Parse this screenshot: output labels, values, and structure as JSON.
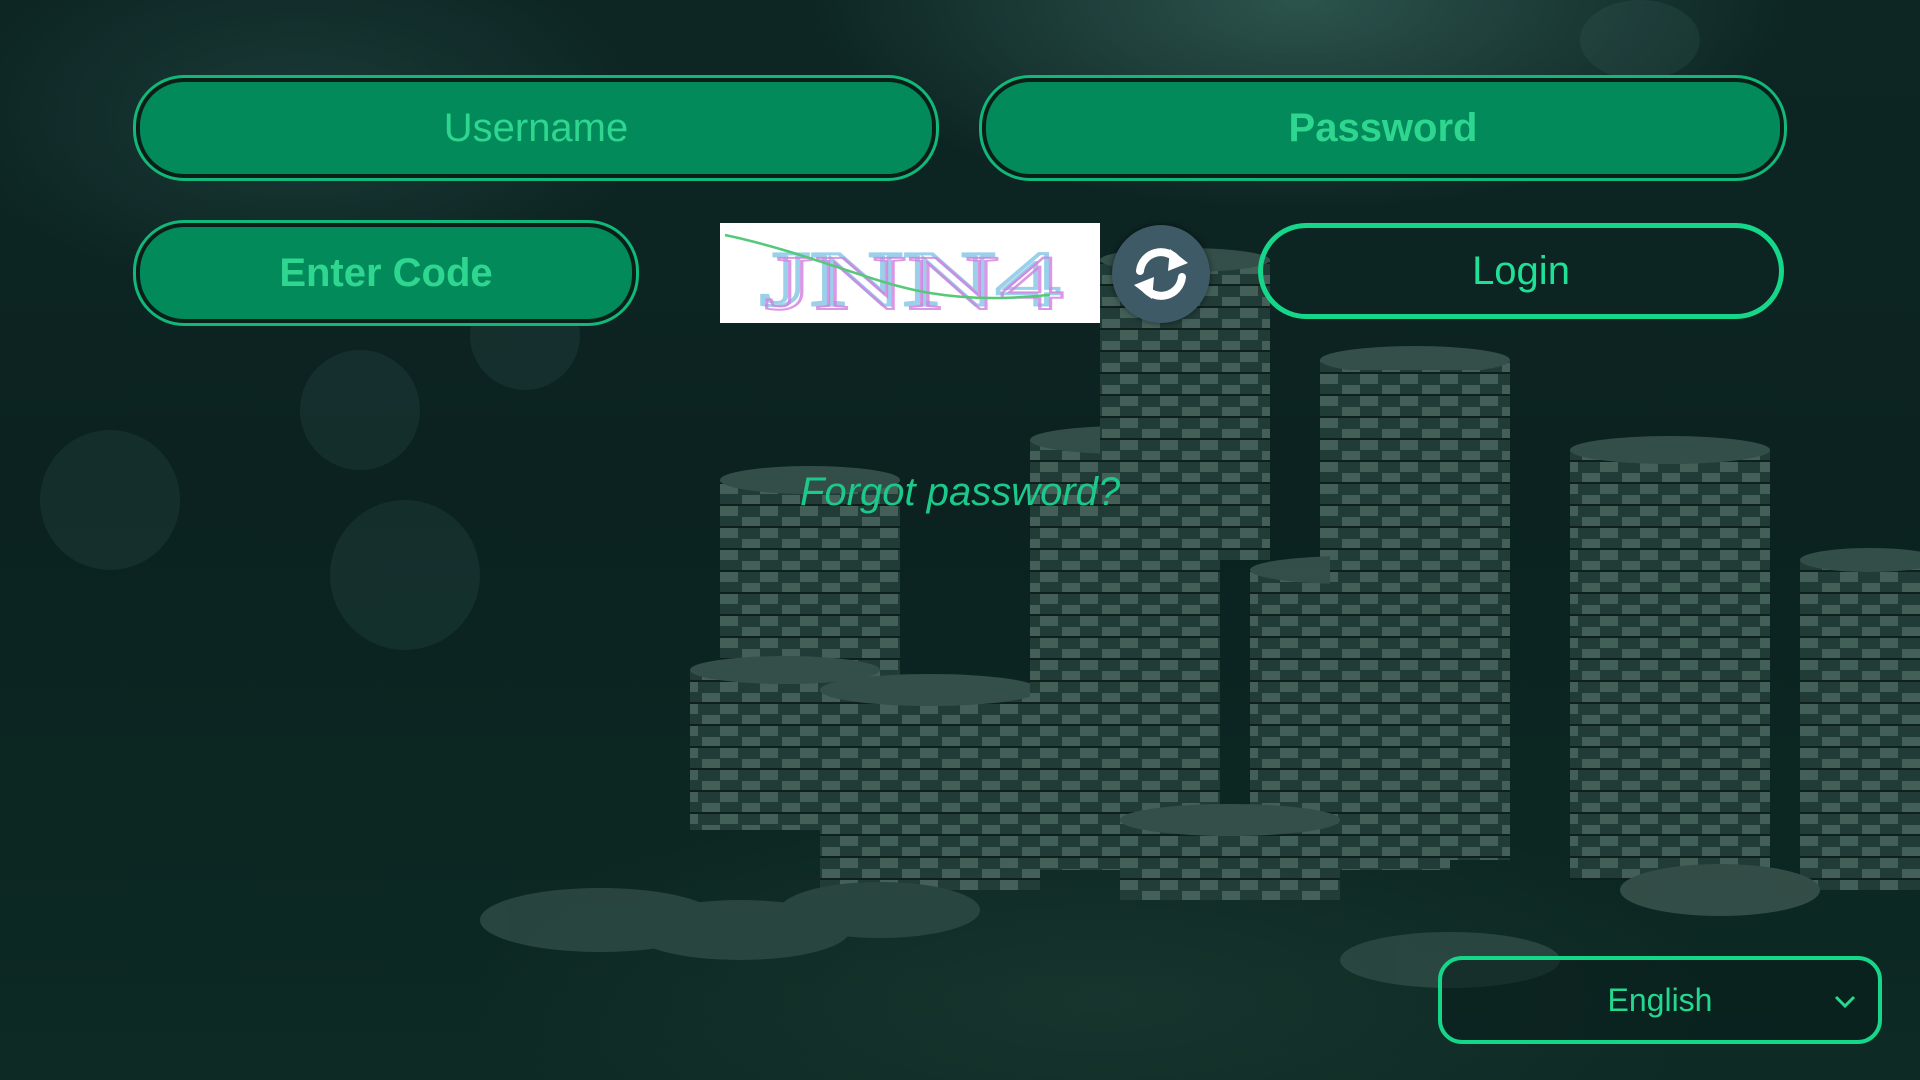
{
  "login_form": {
    "username": {
      "placeholder": "Username",
      "value": ""
    },
    "password": {
      "placeholder": "Password",
      "value": ""
    },
    "code": {
      "placeholder": "Enter Code",
      "value": ""
    },
    "captcha": {
      "text": "JNN4"
    },
    "refresh": {
      "icon": "refresh-icon"
    },
    "login_label": "Login",
    "forgot_label": "Forgot password?"
  },
  "language": {
    "selected": "English",
    "icon": "chevron-down-icon"
  },
  "colors": {
    "field_fill": "#038a5a",
    "accent": "#16d68a",
    "background": "#0b2220"
  }
}
